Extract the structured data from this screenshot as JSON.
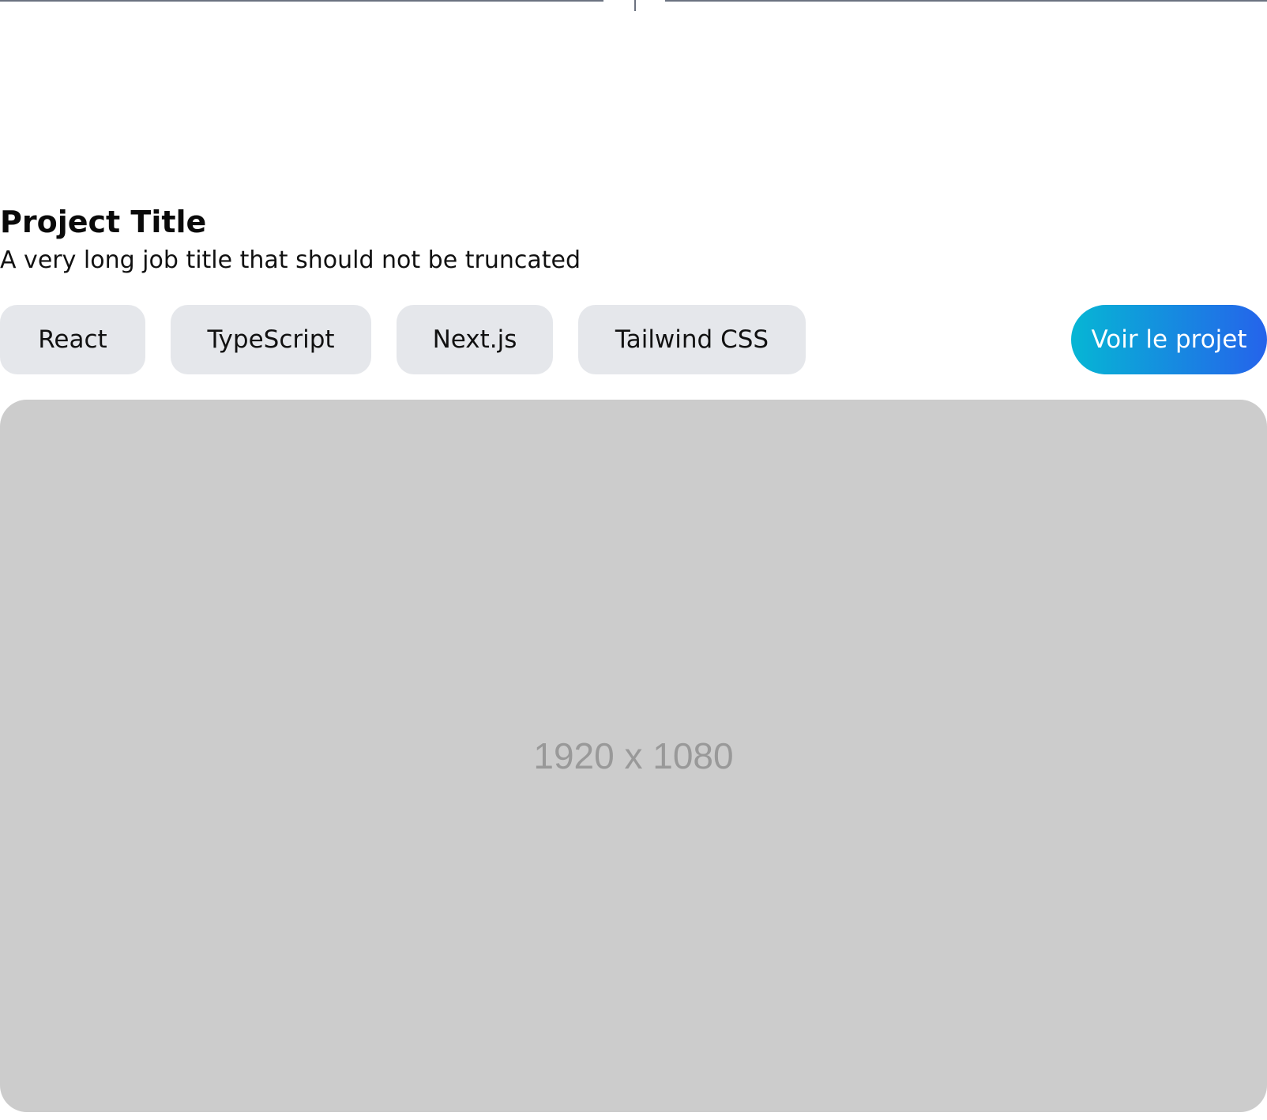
{
  "project": {
    "title": "Project Title",
    "subtitle": "A very long job title that should not be truncated"
  },
  "tags": [
    "React",
    "TypeScript",
    "Next.js",
    "Tailwind CSS"
  ],
  "cta": {
    "label": "Voir le projet"
  },
  "image": {
    "placeholder_text": "1920 x 1080"
  },
  "colors": {
    "tag_background": "#e5e7eb",
    "cta_gradient_start": "#06b6d4",
    "cta_gradient_end": "#2563eb",
    "placeholder_background": "#cccccc",
    "placeholder_text": "#999999",
    "divider": "#6b7280"
  }
}
